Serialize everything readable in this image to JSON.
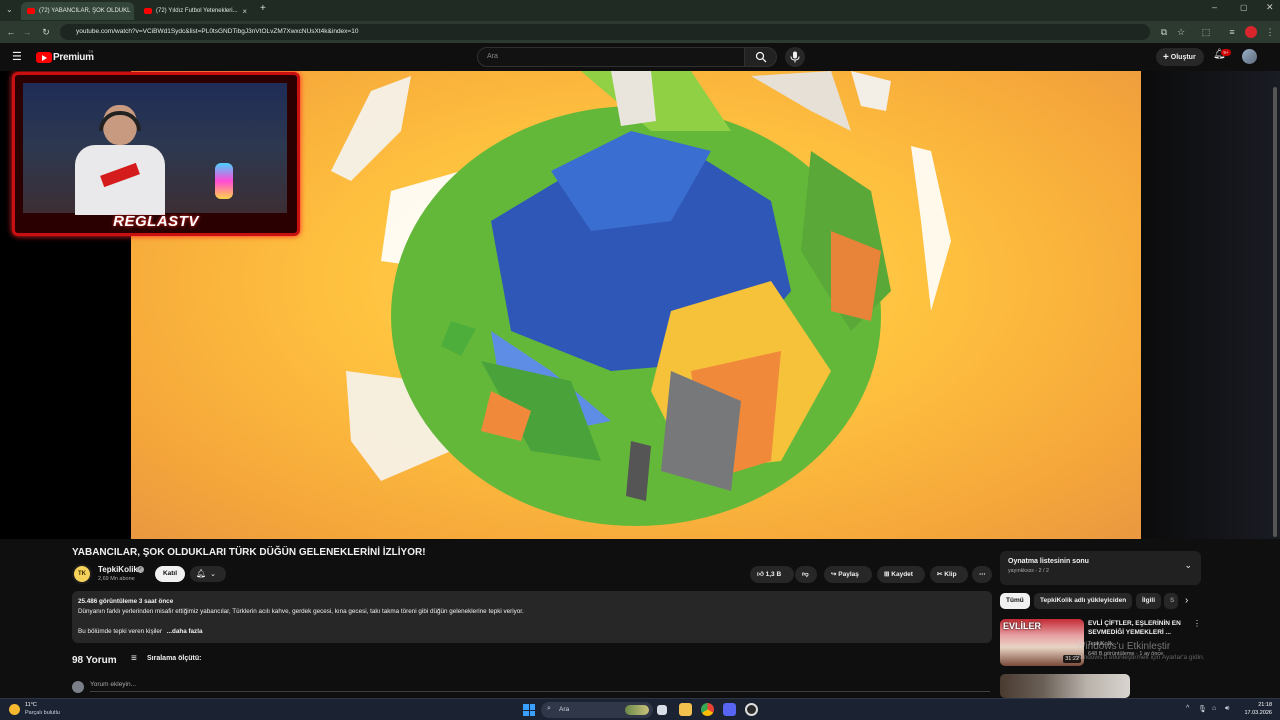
{
  "browser": {
    "tabs": [
      {
        "label": "(72) YABANCILAR, ŞOK OLDUKL",
        "active": true
      },
      {
        "label": "(72) Yıldız Futbol Yetenekleri...",
        "active": false
      }
    ],
    "new_tab_symbol": "+",
    "url": "youtube.com/watch?v=VCiBWd1Sydc&list=PL0tsGNDTibgJ3nVtOLvZM7XwxcNUsXt4k&index=10"
  },
  "header": {
    "logo_text": "Premium",
    "logo_tr": "TR",
    "search_placeholder": "Ara",
    "create_label": "Oluştur",
    "notifications_badge": "9+"
  },
  "player": {
    "webcam_brand": "REGLASTV"
  },
  "video": {
    "title": "YABANCILAR, ŞOK OLDUKLARI TÜRK DÜĞÜN GELENEKLERİNİ İZLİYOR!",
    "channel_name": "TepkiKolik",
    "channel_avatar_text": "TK",
    "subscribers": "2,69 Mn abone",
    "join_label": "Katıl",
    "likes": "1,3 B",
    "share_label": "Paylaş",
    "save_label": "Kaydet",
    "clip_label": "Klip"
  },
  "description": {
    "stats": "25.486 görüntüleme  3 saat önce",
    "line1": "Dünyanın farklı yerlerinden misafir ettiğimiz yabancılar, Türklerin acılı kahve, gerdek gecesi, kına gecesi, takı takma töreni gibi düğün geleneklerine tepki veriyor.",
    "line2": "Bu bölümde tepki veren kişiler",
    "more": "...daha fazla"
  },
  "comments": {
    "count": "98 Yorum",
    "sort_label": "Sıralama ölçütü:",
    "placeholder": "Yorum ekleyin..."
  },
  "sidebar": {
    "playlist_title": "Oynatma listesinin sonu",
    "playlist_sub": "yayınkksss - 2 / 2",
    "chips": [
      "Tümü",
      "TepkiKolik adlı yükleyiciden",
      "İlgili",
      "S"
    ],
    "rec": {
      "thumb_text": "EVLİLER",
      "duration": "31:22",
      "title": "EVLİ ÇİFTLER, EŞLERİNİN EN SEVMEDİĞİ YEMEKLERİ ...",
      "channel": "TepkiKolik",
      "meta": "648 B görüntüleme · 1 ay önce"
    },
    "watermark_title": "Windows'u Etkinleştir",
    "watermark_sub": "Windows'u etkinleştirmek için Ayarlar'a gidin."
  },
  "taskbar": {
    "temperature": "11°C",
    "weather": "Parçalı bulutlu",
    "search_label": "Ara",
    "time": "21:18",
    "date": "17.03.2026"
  },
  "colors": {
    "brand_red": "#ff0000",
    "background": "#0f0f0f",
    "browser_frame": "#1f2b23",
    "video_bg": "#ffc23f"
  }
}
